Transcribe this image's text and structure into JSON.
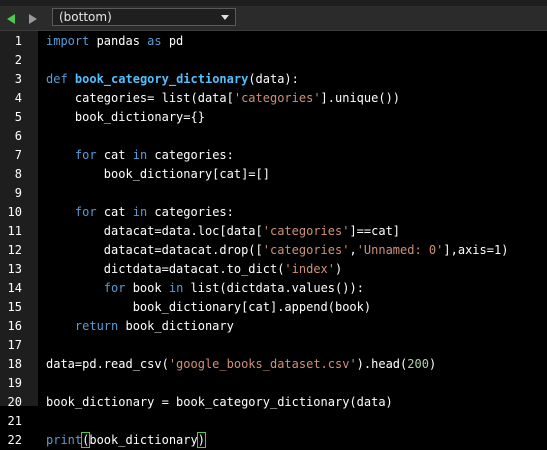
{
  "toolbar": {
    "scope_value": "(bottom)"
  },
  "colors": {
    "background": "#000000",
    "gutter": "#1e1e1e",
    "keyword": "#569cd6",
    "string": "#ce9178",
    "function_name": "#4fc1ff",
    "number": "#b5cea8",
    "arrow": "#4ec94e"
  },
  "icons": {
    "back": "triangle-left-icon",
    "forward": "triangle-right-icon",
    "dropdown": "chevron-down-icon"
  },
  "lines": [
    {
      "n": "1",
      "tokens": [
        {
          "t": "import",
          "c": "kw"
        },
        {
          "t": " pandas ",
          "c": ""
        },
        {
          "t": "as",
          "c": "kw"
        },
        {
          "t": " pd",
          "c": ""
        }
      ]
    },
    {
      "n": "2",
      "tokens": []
    },
    {
      "n": "3",
      "tokens": [
        {
          "t": "def",
          "c": "kw"
        },
        {
          "t": " ",
          "c": ""
        },
        {
          "t": "book_category_dictionary",
          "c": "fn"
        },
        {
          "t": "(data):",
          "c": ""
        }
      ]
    },
    {
      "n": "4",
      "tokens": [
        {
          "t": "    categories= list(data[",
          "c": ""
        },
        {
          "t": "'categories'",
          "c": "str"
        },
        {
          "t": "].unique())",
          "c": ""
        }
      ]
    },
    {
      "n": "5",
      "tokens": [
        {
          "t": "    book_dictionary={}",
          "c": ""
        }
      ]
    },
    {
      "n": "6",
      "tokens": []
    },
    {
      "n": "7",
      "tokens": [
        {
          "t": "    ",
          "c": ""
        },
        {
          "t": "for",
          "c": "kw"
        },
        {
          "t": " cat ",
          "c": ""
        },
        {
          "t": "in",
          "c": "kw"
        },
        {
          "t": " categories:",
          "c": ""
        }
      ]
    },
    {
      "n": "8",
      "tokens": [
        {
          "t": "        book_dictionary[cat]=[]",
          "c": ""
        }
      ]
    },
    {
      "n": "9",
      "tokens": []
    },
    {
      "n": "10",
      "tokens": [
        {
          "t": "    ",
          "c": ""
        },
        {
          "t": "for",
          "c": "kw"
        },
        {
          "t": " cat ",
          "c": ""
        },
        {
          "t": "in",
          "c": "kw"
        },
        {
          "t": " categories:",
          "c": ""
        }
      ]
    },
    {
      "n": "11",
      "tokens": [
        {
          "t": "        datacat=data.loc[data[",
          "c": ""
        },
        {
          "t": "'categories'",
          "c": "str"
        },
        {
          "t": "]==cat]",
          "c": ""
        }
      ]
    },
    {
      "n": "12",
      "tokens": [
        {
          "t": "        datacat=datacat.drop([",
          "c": ""
        },
        {
          "t": "'categories'",
          "c": "str"
        },
        {
          "t": ",",
          "c": ""
        },
        {
          "t": "'Unnamed: 0'",
          "c": "str"
        },
        {
          "t": "],axis=1)",
          "c": ""
        }
      ]
    },
    {
      "n": "13",
      "tokens": [
        {
          "t": "        dictdata=datacat.to_dict(",
          "c": ""
        },
        {
          "t": "'index'",
          "c": "str"
        },
        {
          "t": ")",
          "c": ""
        }
      ]
    },
    {
      "n": "14",
      "tokens": [
        {
          "t": "        ",
          "c": ""
        },
        {
          "t": "for",
          "c": "kw"
        },
        {
          "t": " book ",
          "c": ""
        },
        {
          "t": "in",
          "c": "kw"
        },
        {
          "t": " list(dictdata.values()):",
          "c": ""
        }
      ]
    },
    {
      "n": "15",
      "tokens": [
        {
          "t": "            book_dictionary[cat].append(book)",
          "c": ""
        }
      ]
    },
    {
      "n": "16",
      "tokens": [
        {
          "t": "    ",
          "c": ""
        },
        {
          "t": "return",
          "c": "kw"
        },
        {
          "t": " book_dictionary",
          "c": ""
        }
      ]
    },
    {
      "n": "17",
      "tokens": []
    },
    {
      "n": "18",
      "tokens": [
        {
          "t": "data=pd.read_csv(",
          "c": ""
        },
        {
          "t": "'google_books_dataset.csv'",
          "c": "str"
        },
        {
          "t": ").head(",
          "c": ""
        },
        {
          "t": "200",
          "c": "num"
        },
        {
          "t": ")",
          "c": ""
        }
      ]
    },
    {
      "n": "19",
      "tokens": []
    },
    {
      "n": "20",
      "tokens": [
        {
          "t": "book_dictionary = book_category_dictionary(data)",
          "c": ""
        }
      ]
    },
    {
      "n": "21",
      "tokens": []
    },
    {
      "n": "22",
      "tokens": [
        {
          "t": "print",
          "c": "kw"
        },
        {
          "t": "(",
          "c": "paren-hl"
        },
        {
          "t": "book_dictionary",
          "c": ""
        },
        {
          "t": ")",
          "c": "paren-hl"
        }
      ]
    }
  ]
}
